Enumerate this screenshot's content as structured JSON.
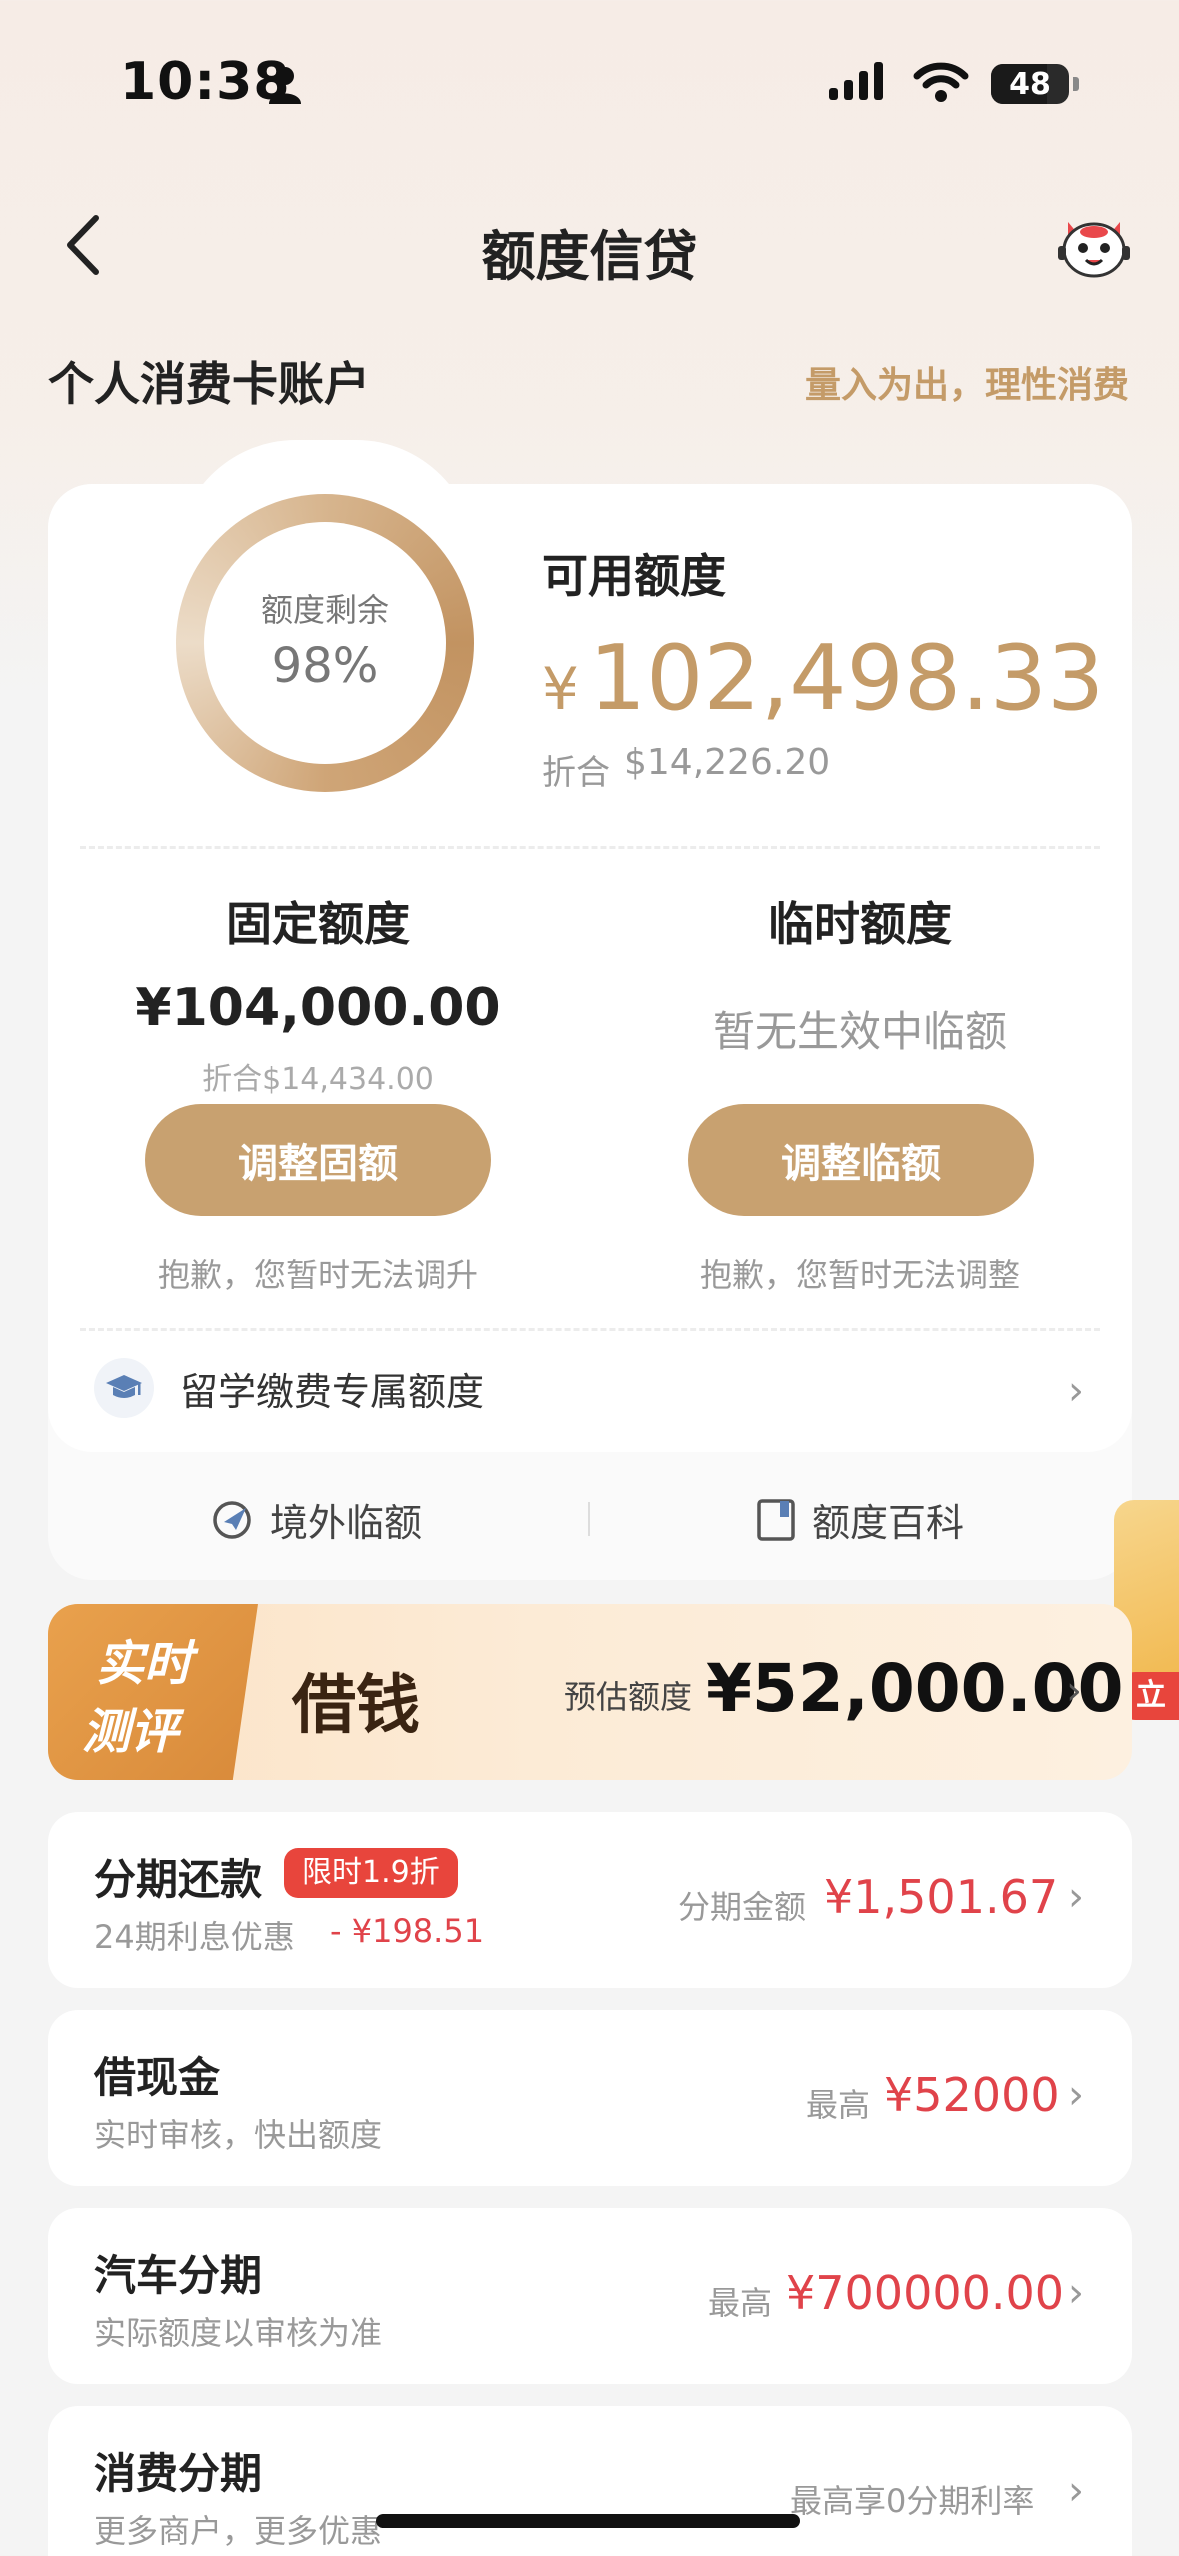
{
  "status_bar": {
    "time": "10:38",
    "battery": "48"
  },
  "nav": {
    "title": "额度信贷"
  },
  "account": {
    "title": "个人消费卡账户",
    "slogan": "量入为出，理性消费"
  },
  "limit_card": {
    "ring_label": "额度剩余",
    "ring_percent": "98%",
    "ring_fraction": 0.98,
    "available_label": "可用额度",
    "available_currency": "¥",
    "available_amount": "102,498.33",
    "available_conv_label": "折合",
    "available_conv": "$14,226.20",
    "fixed": {
      "title": "固定额度",
      "amount": "¥104,000.00",
      "conv": "折合$14,434.00",
      "button": "调整固额",
      "note": "抱歉，您暂时无法调升"
    },
    "temp": {
      "title": "临时额度",
      "status": "暂无生效中临额",
      "button": "调整临额",
      "note": "抱歉，您暂时无法调整"
    },
    "study_row": {
      "label": "留学缴费专属额度"
    },
    "links": {
      "overseas": "境外临额",
      "wiki": "额度百科"
    }
  },
  "side_promo": {
    "badge": "立"
  },
  "banner": {
    "tag_line1": "实时",
    "tag_line2": "测评",
    "title": "借钱",
    "est_label": "预估额度",
    "amount": "¥52,000.00"
  },
  "list": [
    {
      "title": "分期还款",
      "tag": "限时1.9折",
      "sub": "24期利息优惠",
      "discount": "- ¥198.51",
      "right_label": "分期金额",
      "right_amount": "¥1,501.67"
    },
    {
      "title": "借现金",
      "sub": "实时审核，快出额度",
      "right_label": "最高",
      "right_amount": "¥52000"
    },
    {
      "title": "汽车分期",
      "sub": "实际额度以审核为准",
      "right_label": "最高",
      "right_amount": "¥700000.00"
    },
    {
      "title": "消费分期",
      "sub": "更多商户，更多优惠",
      "right_label": "最高享0分期利率"
    }
  ],
  "colors": {
    "gold": "#c49b68",
    "button_gold": "#c8a170",
    "red": "#e0434a"
  }
}
